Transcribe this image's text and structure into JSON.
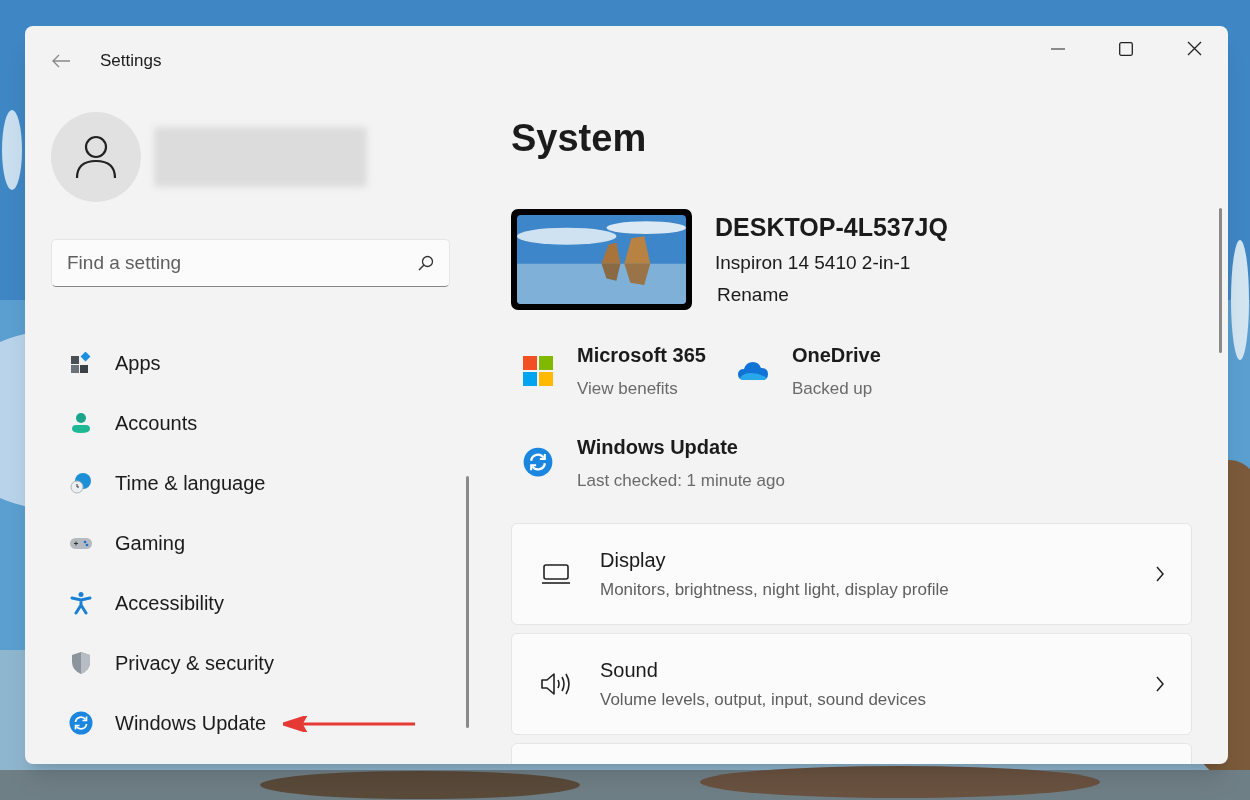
{
  "window": {
    "title": "Settings"
  },
  "search": {
    "placeholder": "Find a setting"
  },
  "sidebar": {
    "items": [
      {
        "label": "Apps"
      },
      {
        "label": "Accounts"
      },
      {
        "label": "Time & language"
      },
      {
        "label": "Gaming"
      },
      {
        "label": "Accessibility"
      },
      {
        "label": "Privacy & security"
      },
      {
        "label": "Windows Update"
      }
    ]
  },
  "page": {
    "title": "System",
    "device": {
      "name": "DESKTOP-4L537JQ",
      "model": "Inspiron 14 5410 2-in-1",
      "rename": "Rename"
    },
    "tiles": [
      {
        "title": "Microsoft 365",
        "subtitle": "View benefits"
      },
      {
        "title": "OneDrive",
        "subtitle": "Backed up"
      },
      {
        "title": "Windows Update",
        "subtitle": "Last checked: 1 minute ago"
      }
    ],
    "cards": [
      {
        "title": "Display",
        "subtitle": "Monitors, brightness, night light, display profile"
      },
      {
        "title": "Sound",
        "subtitle": "Volume levels, output, input, sound devices"
      }
    ]
  }
}
